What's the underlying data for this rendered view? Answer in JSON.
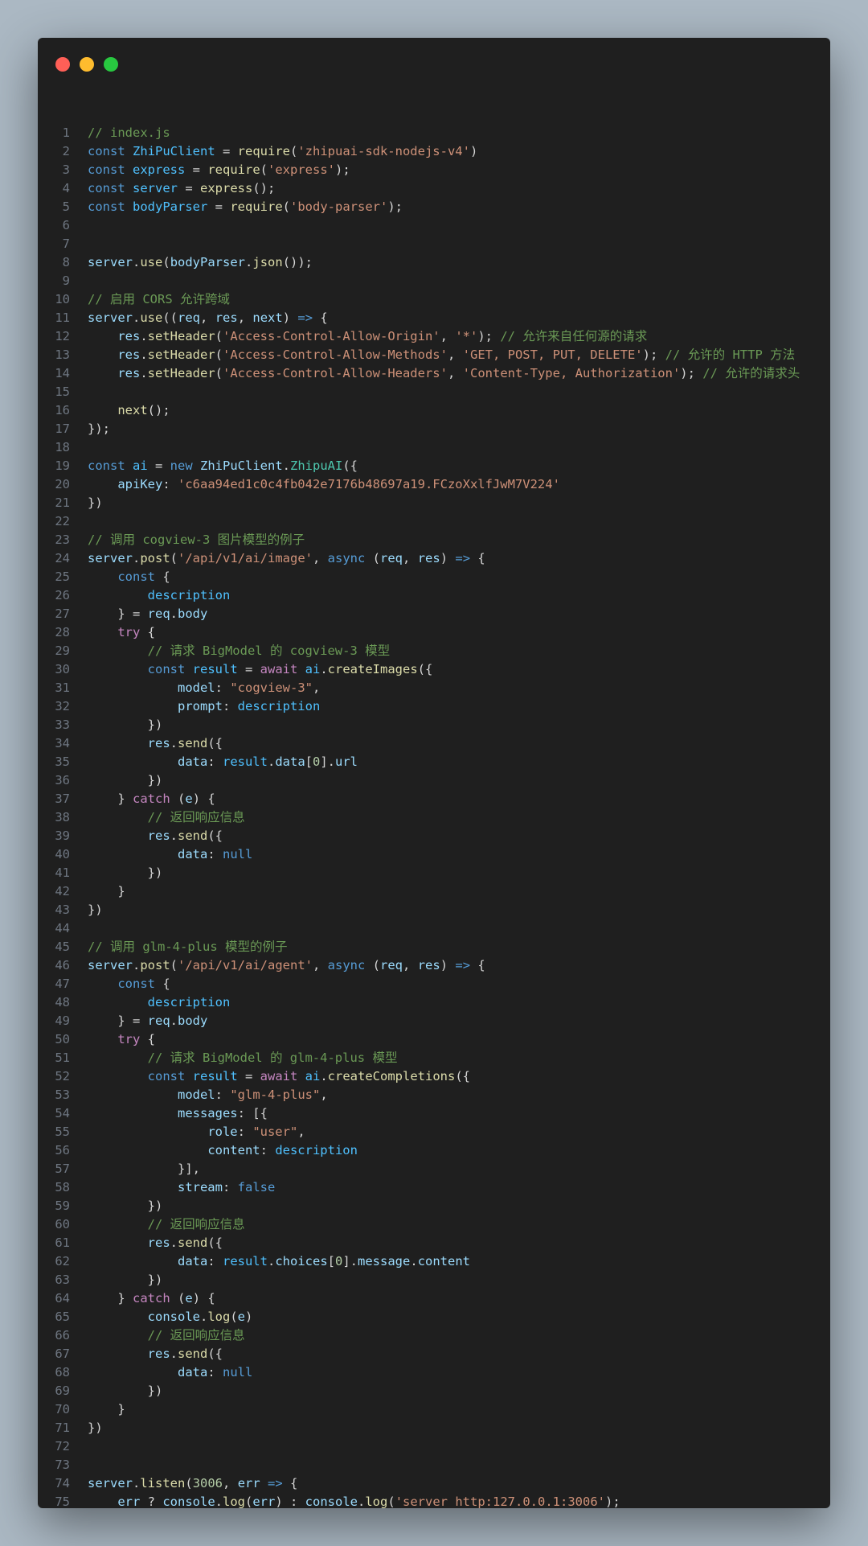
{
  "window": {
    "controls": [
      {
        "name": "close",
        "color": "#ff5f57"
      },
      {
        "name": "minimize",
        "color": "#febc2e"
      },
      {
        "name": "maximize",
        "color": "#28c840"
      }
    ]
  },
  "code": {
    "lines": [
      [
        [
          "c",
          "// index.js"
        ]
      ],
      [
        [
          "k",
          "const "
        ],
        [
          "v2",
          "ZhiPuClient"
        ],
        [
          "p",
          " = "
        ],
        [
          "f",
          "require"
        ],
        [
          "p",
          "("
        ],
        [
          "s",
          "'zhipuai-sdk-nodejs-v4'"
        ],
        [
          "p",
          ")"
        ]
      ],
      [
        [
          "k",
          "const "
        ],
        [
          "v2",
          "express"
        ],
        [
          "p",
          " = "
        ],
        [
          "f",
          "require"
        ],
        [
          "p",
          "("
        ],
        [
          "s",
          "'express'"
        ],
        [
          "p",
          ");"
        ]
      ],
      [
        [
          "k",
          "const "
        ],
        [
          "v2",
          "server"
        ],
        [
          "p",
          " = "
        ],
        [
          "f",
          "express"
        ],
        [
          "p",
          "();"
        ]
      ],
      [
        [
          "k",
          "const "
        ],
        [
          "v2",
          "bodyParser"
        ],
        [
          "p",
          " = "
        ],
        [
          "f",
          "require"
        ],
        [
          "p",
          "("
        ],
        [
          "s",
          "'body-parser'"
        ],
        [
          "p",
          ");"
        ]
      ],
      [],
      [],
      [
        [
          "v",
          "server"
        ],
        [
          "p",
          "."
        ],
        [
          "f",
          "use"
        ],
        [
          "p",
          "("
        ],
        [
          "v",
          "bodyParser"
        ],
        [
          "p",
          "."
        ],
        [
          "f",
          "json"
        ],
        [
          "p",
          "());"
        ]
      ],
      [],
      [
        [
          "c",
          "// 启用 CORS 允许跨域"
        ]
      ],
      [
        [
          "v",
          "server"
        ],
        [
          "p",
          "."
        ],
        [
          "f",
          "use"
        ],
        [
          "p",
          "(("
        ],
        [
          "v",
          "req"
        ],
        [
          "p",
          ", "
        ],
        [
          "v",
          "res"
        ],
        [
          "p",
          ", "
        ],
        [
          "v",
          "next"
        ],
        [
          "p",
          ") "
        ],
        [
          "k",
          "=>"
        ],
        [
          "p",
          " {"
        ]
      ],
      [
        [
          "p",
          "    "
        ],
        [
          "v",
          "res"
        ],
        [
          "p",
          "."
        ],
        [
          "f",
          "setHeader"
        ],
        [
          "p",
          "("
        ],
        [
          "s",
          "'Access-Control-Allow-Origin'"
        ],
        [
          "p",
          ", "
        ],
        [
          "s",
          "'*'"
        ],
        [
          "p",
          "); "
        ],
        [
          "c",
          "// 允许来自任何源的请求"
        ]
      ],
      [
        [
          "p",
          "    "
        ],
        [
          "v",
          "res"
        ],
        [
          "p",
          "."
        ],
        [
          "f",
          "setHeader"
        ],
        [
          "p",
          "("
        ],
        [
          "s",
          "'Access-Control-Allow-Methods'"
        ],
        [
          "p",
          ", "
        ],
        [
          "s",
          "'GET, POST, PUT, DELETE'"
        ],
        [
          "p",
          "); "
        ],
        [
          "c",
          "// 允许的 HTTP 方法"
        ]
      ],
      [
        [
          "p",
          "    "
        ],
        [
          "v",
          "res"
        ],
        [
          "p",
          "."
        ],
        [
          "f",
          "setHeader"
        ],
        [
          "p",
          "("
        ],
        [
          "s",
          "'Access-Control-Allow-Headers'"
        ],
        [
          "p",
          ", "
        ],
        [
          "s",
          "'Content-Type, Authorization'"
        ],
        [
          "p",
          "); "
        ],
        [
          "c",
          "// 允许的请求头"
        ]
      ],
      [],
      [
        [
          "p",
          "    "
        ],
        [
          "f",
          "next"
        ],
        [
          "p",
          "();"
        ]
      ],
      [
        [
          "p",
          "});"
        ]
      ],
      [],
      [
        [
          "k",
          "const "
        ],
        [
          "v2",
          "ai"
        ],
        [
          "p",
          " = "
        ],
        [
          "k",
          "new "
        ],
        [
          "v",
          "ZhiPuClient"
        ],
        [
          "p",
          "."
        ],
        [
          "t",
          "ZhipuAI"
        ],
        [
          "p",
          "({"
        ]
      ],
      [
        [
          "p",
          "    "
        ],
        [
          "v",
          "apiKey"
        ],
        [
          "p",
          ": "
        ],
        [
          "s",
          "'c6aa94ed1c0c4fb042e7176b48697a19.FCzoXxlfJwM7V224'"
        ]
      ],
      [
        [
          "p",
          "})"
        ]
      ],
      [],
      [
        [
          "c",
          "// 调用 cogview-3 图片模型的例子"
        ]
      ],
      [
        [
          "v",
          "server"
        ],
        [
          "p",
          "."
        ],
        [
          "f",
          "post"
        ],
        [
          "p",
          "("
        ],
        [
          "s",
          "'/api/v1/ai/image'"
        ],
        [
          "p",
          ", "
        ],
        [
          "k",
          "async "
        ],
        [
          "p",
          "("
        ],
        [
          "v",
          "req"
        ],
        [
          "p",
          ", "
        ],
        [
          "v",
          "res"
        ],
        [
          "p",
          ") "
        ],
        [
          "k",
          "=>"
        ],
        [
          "p",
          " {"
        ]
      ],
      [
        [
          "p",
          "    "
        ],
        [
          "k",
          "const "
        ],
        [
          "p",
          "{"
        ]
      ],
      [
        [
          "p",
          "        "
        ],
        [
          "v2",
          "description"
        ]
      ],
      [
        [
          "p",
          "    } = "
        ],
        [
          "v",
          "req"
        ],
        [
          "p",
          "."
        ],
        [
          "v",
          "body"
        ]
      ],
      [
        [
          "p",
          "    "
        ],
        [
          "k2",
          "try"
        ],
        [
          "p",
          " {"
        ]
      ],
      [
        [
          "p",
          "        "
        ],
        [
          "c",
          "// 请求 BigModel 的 cogview-3 模型"
        ]
      ],
      [
        [
          "p",
          "        "
        ],
        [
          "k",
          "const "
        ],
        [
          "v2",
          "result"
        ],
        [
          "p",
          " = "
        ],
        [
          "k2",
          "await "
        ],
        [
          "v2",
          "ai"
        ],
        [
          "p",
          "."
        ],
        [
          "f",
          "createImages"
        ],
        [
          "p",
          "({"
        ]
      ],
      [
        [
          "p",
          "            "
        ],
        [
          "v",
          "model"
        ],
        [
          "p",
          ": "
        ],
        [
          "s",
          "\"cogview-3\""
        ],
        [
          "p",
          ","
        ]
      ],
      [
        [
          "p",
          "            "
        ],
        [
          "v",
          "prompt"
        ],
        [
          "p",
          ": "
        ],
        [
          "v2",
          "description"
        ]
      ],
      [
        [
          "p",
          "        })"
        ]
      ],
      [
        [
          "p",
          "        "
        ],
        [
          "v",
          "res"
        ],
        [
          "p",
          "."
        ],
        [
          "f",
          "send"
        ],
        [
          "p",
          "({"
        ]
      ],
      [
        [
          "p",
          "            "
        ],
        [
          "v",
          "data"
        ],
        [
          "p",
          ": "
        ],
        [
          "v2",
          "result"
        ],
        [
          "p",
          "."
        ],
        [
          "v",
          "data"
        ],
        [
          "p",
          "["
        ],
        [
          "n",
          "0"
        ],
        [
          "p",
          "]."
        ],
        [
          "v",
          "url"
        ]
      ],
      [
        [
          "p",
          "        })"
        ]
      ],
      [
        [
          "p",
          "    } "
        ],
        [
          "k2",
          "catch"
        ],
        [
          "p",
          " ("
        ],
        [
          "v",
          "e"
        ],
        [
          "p",
          ") {"
        ]
      ],
      [
        [
          "p",
          "        "
        ],
        [
          "c",
          "// 返回响应信息"
        ]
      ],
      [
        [
          "p",
          "        "
        ],
        [
          "v",
          "res"
        ],
        [
          "p",
          "."
        ],
        [
          "f",
          "send"
        ],
        [
          "p",
          "({"
        ]
      ],
      [
        [
          "p",
          "            "
        ],
        [
          "v",
          "data"
        ],
        [
          "p",
          ": "
        ],
        [
          "k",
          "null"
        ]
      ],
      [
        [
          "p",
          "        })"
        ]
      ],
      [
        [
          "p",
          "    }"
        ]
      ],
      [
        [
          "p",
          "})"
        ]
      ],
      [],
      [
        [
          "c",
          "// 调用 glm-4-plus 模型的例子"
        ]
      ],
      [
        [
          "v",
          "server"
        ],
        [
          "p",
          "."
        ],
        [
          "f",
          "post"
        ],
        [
          "p",
          "("
        ],
        [
          "s",
          "'/api/v1/ai/agent'"
        ],
        [
          "p",
          ", "
        ],
        [
          "k",
          "async "
        ],
        [
          "p",
          "("
        ],
        [
          "v",
          "req"
        ],
        [
          "p",
          ", "
        ],
        [
          "v",
          "res"
        ],
        [
          "p",
          ") "
        ],
        [
          "k",
          "=>"
        ],
        [
          "p",
          " {"
        ]
      ],
      [
        [
          "p",
          "    "
        ],
        [
          "k",
          "const "
        ],
        [
          "p",
          "{"
        ]
      ],
      [
        [
          "p",
          "        "
        ],
        [
          "v2",
          "description"
        ]
      ],
      [
        [
          "p",
          "    } = "
        ],
        [
          "v",
          "req"
        ],
        [
          "p",
          "."
        ],
        [
          "v",
          "body"
        ]
      ],
      [
        [
          "p",
          "    "
        ],
        [
          "k2",
          "try"
        ],
        [
          "p",
          " {"
        ]
      ],
      [
        [
          "p",
          "        "
        ],
        [
          "c",
          "// 请求 BigModel 的 glm-4-plus 模型"
        ]
      ],
      [
        [
          "p",
          "        "
        ],
        [
          "k",
          "const "
        ],
        [
          "v2",
          "result"
        ],
        [
          "p",
          " = "
        ],
        [
          "k2",
          "await "
        ],
        [
          "v2",
          "ai"
        ],
        [
          "p",
          "."
        ],
        [
          "f",
          "createCompletions"
        ],
        [
          "p",
          "({"
        ]
      ],
      [
        [
          "p",
          "            "
        ],
        [
          "v",
          "model"
        ],
        [
          "p",
          ": "
        ],
        [
          "s",
          "\"glm-4-plus\""
        ],
        [
          "p",
          ","
        ]
      ],
      [
        [
          "p",
          "            "
        ],
        [
          "v",
          "messages"
        ],
        [
          "p",
          ": [{"
        ]
      ],
      [
        [
          "p",
          "                "
        ],
        [
          "v",
          "role"
        ],
        [
          "p",
          ": "
        ],
        [
          "s",
          "\"user\""
        ],
        [
          "p",
          ","
        ]
      ],
      [
        [
          "p",
          "                "
        ],
        [
          "v",
          "content"
        ],
        [
          "p",
          ": "
        ],
        [
          "v2",
          "description"
        ]
      ],
      [
        [
          "p",
          "            }],"
        ]
      ],
      [
        [
          "p",
          "            "
        ],
        [
          "v",
          "stream"
        ],
        [
          "p",
          ": "
        ],
        [
          "k",
          "false"
        ]
      ],
      [
        [
          "p",
          "        })"
        ]
      ],
      [
        [
          "p",
          "        "
        ],
        [
          "c",
          "// 返回响应信息"
        ]
      ],
      [
        [
          "p",
          "        "
        ],
        [
          "v",
          "res"
        ],
        [
          "p",
          "."
        ],
        [
          "f",
          "send"
        ],
        [
          "p",
          "({"
        ]
      ],
      [
        [
          "p",
          "            "
        ],
        [
          "v",
          "data"
        ],
        [
          "p",
          ": "
        ],
        [
          "v2",
          "result"
        ],
        [
          "p",
          "."
        ],
        [
          "v",
          "choices"
        ],
        [
          "p",
          "["
        ],
        [
          "n",
          "0"
        ],
        [
          "p",
          "]."
        ],
        [
          "v",
          "message"
        ],
        [
          "p",
          "."
        ],
        [
          "v",
          "content"
        ]
      ],
      [
        [
          "p",
          "        })"
        ]
      ],
      [
        [
          "p",
          "    } "
        ],
        [
          "k2",
          "catch"
        ],
        [
          "p",
          " ("
        ],
        [
          "v",
          "e"
        ],
        [
          "p",
          ") {"
        ]
      ],
      [
        [
          "p",
          "        "
        ],
        [
          "v",
          "console"
        ],
        [
          "p",
          "."
        ],
        [
          "f",
          "log"
        ],
        [
          "p",
          "("
        ],
        [
          "v",
          "e"
        ],
        [
          "p",
          ")"
        ]
      ],
      [
        [
          "p",
          "        "
        ],
        [
          "c",
          "// 返回响应信息"
        ]
      ],
      [
        [
          "p",
          "        "
        ],
        [
          "v",
          "res"
        ],
        [
          "p",
          "."
        ],
        [
          "f",
          "send"
        ],
        [
          "p",
          "({"
        ]
      ],
      [
        [
          "p",
          "            "
        ],
        [
          "v",
          "data"
        ],
        [
          "p",
          ": "
        ],
        [
          "k",
          "null"
        ]
      ],
      [
        [
          "p",
          "        })"
        ]
      ],
      [
        [
          "p",
          "    }"
        ]
      ],
      [
        [
          "p",
          "})"
        ]
      ],
      [],
      [],
      [
        [
          "v",
          "server"
        ],
        [
          "p",
          "."
        ],
        [
          "f",
          "listen"
        ],
        [
          "p",
          "("
        ],
        [
          "n",
          "3006"
        ],
        [
          "p",
          ", "
        ],
        [
          "v",
          "err"
        ],
        [
          "p",
          " "
        ],
        [
          "k",
          "=>"
        ],
        [
          "p",
          " {"
        ]
      ],
      [
        [
          "p",
          "    "
        ],
        [
          "v",
          "err"
        ],
        [
          "p",
          " ? "
        ],
        [
          "v",
          "console"
        ],
        [
          "p",
          "."
        ],
        [
          "f",
          "log"
        ],
        [
          "p",
          "("
        ],
        [
          "v",
          "err"
        ],
        [
          "p",
          ") : "
        ],
        [
          "v",
          "console"
        ],
        [
          "p",
          "."
        ],
        [
          "f",
          "log"
        ],
        [
          "p",
          "("
        ],
        [
          "s",
          "'server http:127.0.0.1:3006'"
        ],
        [
          "p",
          ");"
        ]
      ],
      [
        [
          "p",
          "})"
        ]
      ]
    ]
  }
}
